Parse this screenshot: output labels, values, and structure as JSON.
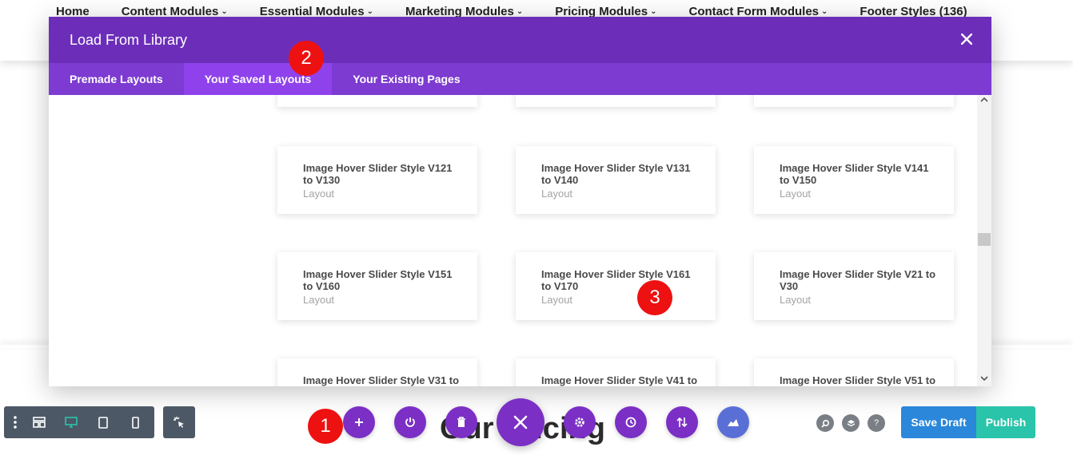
{
  "site_nav": {
    "items": [
      {
        "label": "Home",
        "dropdown": false
      },
      {
        "label": "Content Modules",
        "dropdown": true
      },
      {
        "label": "Essential Modules",
        "dropdown": true
      },
      {
        "label": "Marketing Modules",
        "dropdown": true
      },
      {
        "label": "Pricing Modules",
        "dropdown": true
      },
      {
        "label": "Contact Form Modules",
        "dropdown": true
      },
      {
        "label": "Footer Styles (136)",
        "dropdown": false
      }
    ]
  },
  "page": {
    "heading": "Our Pricing"
  },
  "modal": {
    "title": "Load From Library",
    "close_icon": "close-icon",
    "tabs": [
      {
        "label": "Premade Layouts",
        "active": false
      },
      {
        "label": "Your Saved Layouts",
        "active": true
      },
      {
        "label": "Your Existing Pages",
        "active": false
      }
    ],
    "cards": [
      {
        "title": "Image Hover Slider Style V121 to V130",
        "sub": "Layout"
      },
      {
        "title": "Image Hover Slider Style V131 to V140",
        "sub": "Layout"
      },
      {
        "title": "Image Hover Slider Style V141 to V150",
        "sub": "Layout"
      },
      {
        "title": "Image Hover Slider Style V151 to V160",
        "sub": "Layout"
      },
      {
        "title": "Image Hover Slider Style V161 to V170",
        "sub": "Layout"
      },
      {
        "title": "Image Hover Slider Style V21 to V30",
        "sub": "Layout"
      },
      {
        "title": "Image Hover Slider Style V31 to",
        "sub": ""
      },
      {
        "title": "Image Hover Slider Style V41 to",
        "sub": ""
      },
      {
        "title": "Image Hover Slider Style V51 to",
        "sub": ""
      }
    ]
  },
  "markers": [
    "1",
    "2",
    "3"
  ],
  "toolbar": {
    "save_draft": "Save Draft",
    "publish": "Publish"
  },
  "colors": {
    "modal_header": "#6c2eb9",
    "modal_tabs": "#7d3bd1",
    "active_tab": "#8f42ec",
    "builder_purple": "#7b2fc5",
    "save_draft": "#2b87da",
    "publish": "#29c4a9",
    "marker": "#ee1111"
  }
}
